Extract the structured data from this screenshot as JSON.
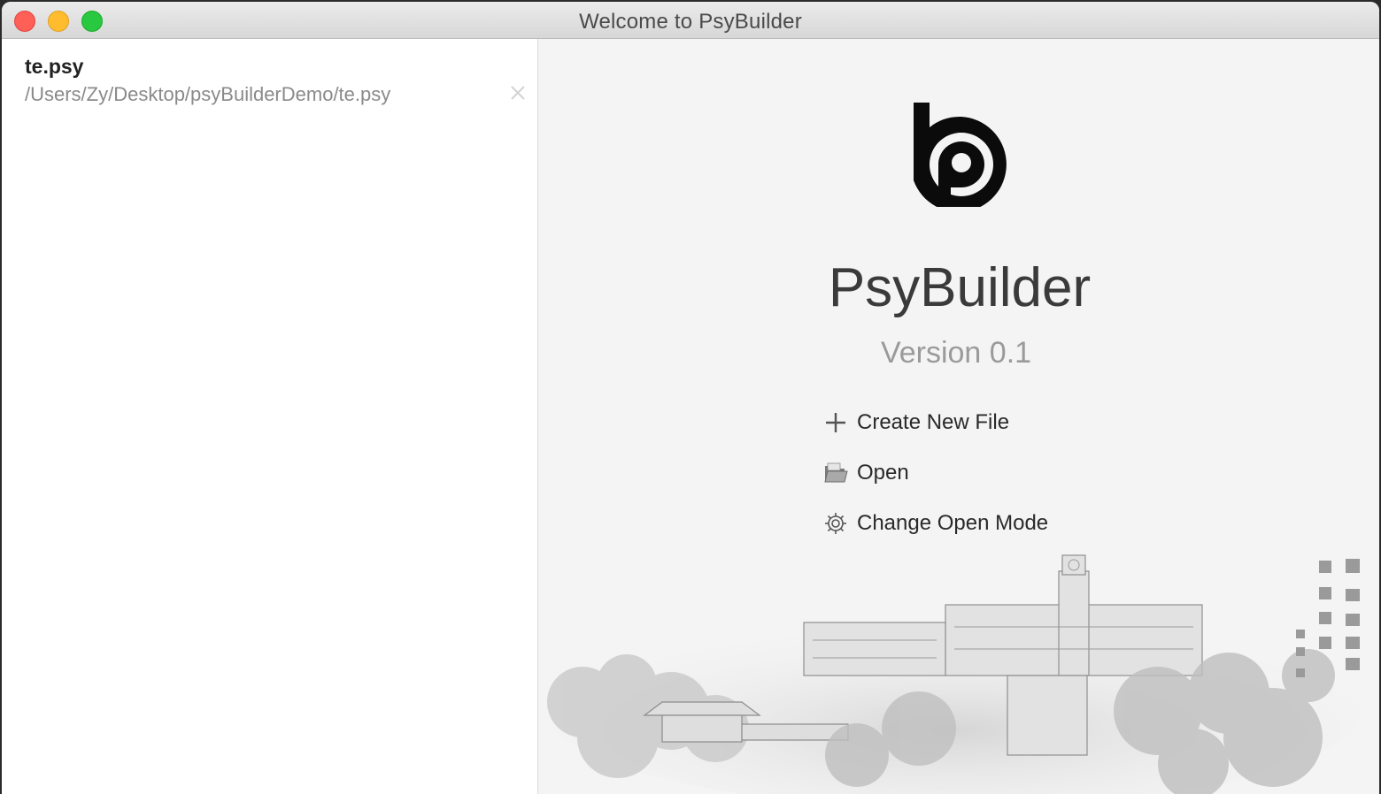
{
  "window": {
    "title": "Welcome to PsyBuilder"
  },
  "recent_files": [
    {
      "name": "te.psy",
      "path": "/Users/Zy/Desktop/psyBuilderDemo/te.psy"
    }
  ],
  "welcome": {
    "app_name": "PsyBuilder",
    "version": "Version 0.1",
    "actions": {
      "create": "Create New File",
      "open": "Open",
      "change_mode": "Change Open Mode"
    }
  },
  "icons": {
    "create": "plus-icon",
    "open": "folder-icon",
    "change_mode": "gear-icon",
    "remove": "close-icon"
  },
  "colors": {
    "close": "#fe5f57",
    "minimize": "#febc2e",
    "maximize": "#28c840"
  }
}
